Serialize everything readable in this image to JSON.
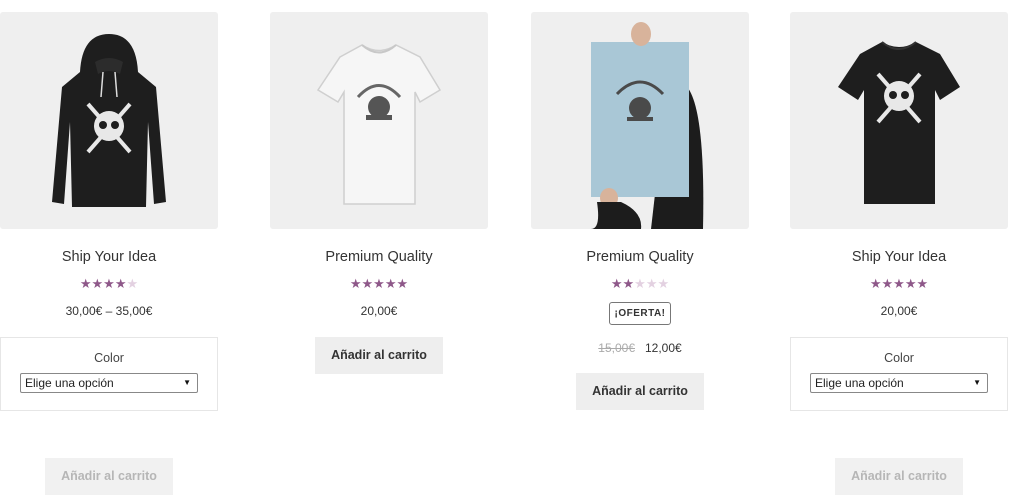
{
  "products": [
    {
      "title": "Premium Quality",
      "rating": 4.5,
      "rating_max": 5,
      "price": "20,00€",
      "button_label": "Añadir al carrito",
      "image": "white-tshirt-woothemes"
    },
    {
      "title": "Premium Quality",
      "rating": 2,
      "rating_max": 5,
      "sale_badge": "¡OFERTA!",
      "old_price": "15,00€",
      "price": "12,00€",
      "button_label": "Añadir al carrito",
      "image": "poster-woothemes"
    },
    {
      "title": "Ship Your Idea",
      "rating": 4.5,
      "rating_max": 5,
      "price": "20,00€",
      "variation_label": "Color",
      "select_value": "Elige una opción",
      "button_label": "Añadir al carrito",
      "button_disabled": true,
      "image": "black-tshirt-skull"
    },
    {
      "title": "Ship Your Idea",
      "rating": 4,
      "rating_max": 5,
      "price": "30,00€ – 35,00€",
      "variation_label": "Color",
      "select_value": "Elige una opción",
      "button_label": "Añadir al carrito",
      "button_disabled": true,
      "image": "black-hoodie-skull"
    }
  ],
  "colors": {
    "star_on": "#8e5889",
    "star_off": "#e3d1e1",
    "card_bg": "#efefef",
    "button_bg": "#eeeeee"
  }
}
